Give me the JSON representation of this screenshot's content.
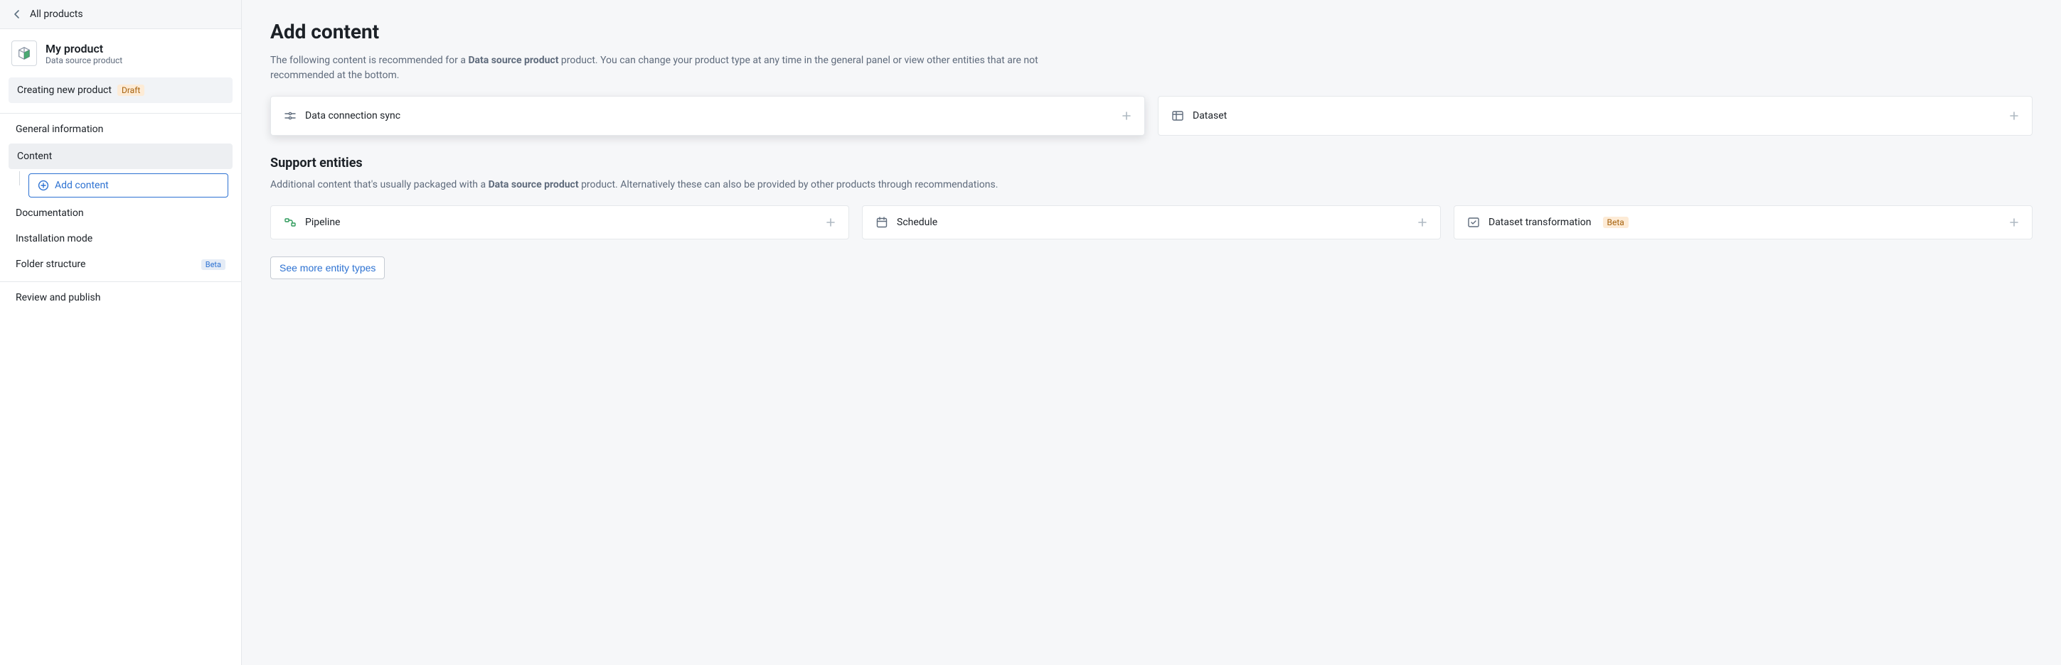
{
  "back": {
    "label": "All products"
  },
  "product": {
    "name": "My product",
    "type": "Data source product"
  },
  "status": {
    "text": "Creating new product",
    "badge": "Draft"
  },
  "nav": {
    "general": "General information",
    "content": "Content",
    "add_content": "Add content",
    "documentation": "Documentation",
    "installation": "Installation mode",
    "folder": "Folder structure",
    "folder_badge": "Beta",
    "review": "Review and publish"
  },
  "main": {
    "title": "Add content",
    "intro_pre": "The following content is recommended for a ",
    "intro_bold": "Data source product",
    "intro_post": " product. You can change your product type at any time in the general panel or view other entities that are not recommended at the bottom.",
    "cards": {
      "data_connection_sync": "Data connection sync",
      "dataset": "Dataset"
    },
    "support_title": "Support entities",
    "support_intro_pre": "Additional content that's usually packaged with a ",
    "support_intro_bold": "Data source product",
    "support_intro_post": " product. Alternatively these can also be provided by other products through recommendations.",
    "support_cards": {
      "pipeline": "Pipeline",
      "schedule": "Schedule",
      "dataset_transformation": "Dataset transformation",
      "dataset_transformation_badge": "Beta"
    },
    "see_more": "See more entity types"
  }
}
